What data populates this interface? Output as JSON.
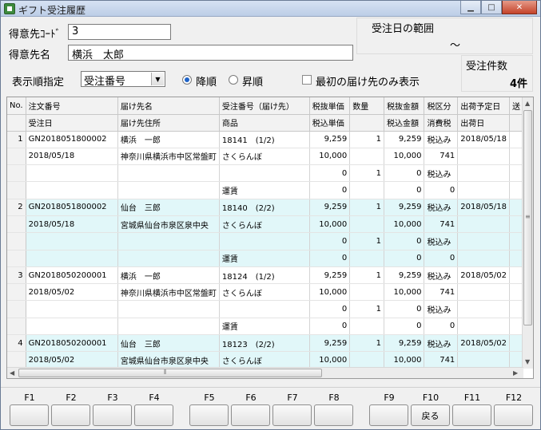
{
  "window": {
    "title": "ギフト受注履歴"
  },
  "form": {
    "customer_code_label": "得意先ｺｰﾄﾞ",
    "customer_code_value": "3",
    "customer_name_label": "得意先名",
    "customer_name_value": "横浜　太郎",
    "date_range_label": "受注日の範囲",
    "date_range_sep": "～",
    "order_count_label": "受注件数",
    "order_count_value": "4件",
    "sort_label": "表示順指定",
    "sort_value": "受注番号",
    "desc_label": "降順",
    "asc_label": "昇順",
    "first_only_label": "最初の届け先のみ表示"
  },
  "grid": {
    "header1": [
      "No.",
      "注文番号",
      "届け先名",
      "受注番号（届け先）",
      "税抜単価",
      "数量",
      "税抜金額",
      "税区分",
      "出荷予定日",
      "送"
    ],
    "header2": [
      "",
      "受注日",
      "届け先住所",
      "商品",
      "税込単価",
      "",
      "税込金額",
      "消費税",
      "出荷日",
      ""
    ],
    "groups": [
      {
        "no": "1",
        "alt": false,
        "rows": [
          [
            "GN2018051800002",
            "横浜　一郎",
            "18141　(1/2)",
            "9,259",
            "1",
            "9,259",
            "税込み",
            "2018/05/18"
          ],
          [
            "2018/05/18",
            "神奈川県横浜市中区常盤町",
            "さくらんぼ",
            "10,000",
            "",
            "10,000",
            "741",
            ""
          ],
          [
            "",
            "",
            "",
            "0",
            "1",
            "0",
            "税込み",
            ""
          ],
          [
            "",
            "",
            "運賃",
            "0",
            "",
            "0",
            "0",
            ""
          ]
        ]
      },
      {
        "no": "2",
        "alt": true,
        "rows": [
          [
            "GN2018051800002",
            "仙台　三郎",
            "18140　(2/2)",
            "9,259",
            "1",
            "9,259",
            "税込み",
            "2018/05/18"
          ],
          [
            "2018/05/18",
            "宮城県仙台市泉区泉中央",
            "さくらんぼ",
            "10,000",
            "",
            "10,000",
            "741",
            ""
          ],
          [
            "",
            "",
            "",
            "0",
            "1",
            "0",
            "税込み",
            ""
          ],
          [
            "",
            "",
            "運賃",
            "0",
            "",
            "0",
            "0",
            ""
          ]
        ]
      },
      {
        "no": "3",
        "alt": false,
        "rows": [
          [
            "GN2018050200001",
            "横浜　一郎",
            "18124　(1/2)",
            "9,259",
            "1",
            "9,259",
            "税込み",
            "2018/05/02"
          ],
          [
            "2018/05/02",
            "神奈川県横浜市中区常盤町",
            "さくらんぼ",
            "10,000",
            "",
            "10,000",
            "741",
            ""
          ],
          [
            "",
            "",
            "",
            "0",
            "1",
            "0",
            "税込み",
            ""
          ],
          [
            "",
            "",
            "運賃",
            "0",
            "",
            "0",
            "0",
            ""
          ]
        ]
      },
      {
        "no": "4",
        "alt": true,
        "rows": [
          [
            "GN2018050200001",
            "仙台　三郎",
            "18123　(2/2)",
            "9,259",
            "1",
            "9,259",
            "税込み",
            "2018/05/02"
          ],
          [
            "2018/05/02",
            "宮城県仙台市泉区泉中央",
            "さくらんぼ",
            "10,000",
            "",
            "10,000",
            "741",
            ""
          ]
        ]
      }
    ]
  },
  "fkeys": [
    {
      "key": "F1",
      "label": ""
    },
    {
      "key": "F2",
      "label": ""
    },
    {
      "key": "F3",
      "label": ""
    },
    {
      "key": "F4",
      "label": ""
    },
    {
      "key": "F5",
      "label": ""
    },
    {
      "key": "F6",
      "label": ""
    },
    {
      "key": "F7",
      "label": ""
    },
    {
      "key": "F8",
      "label": ""
    },
    {
      "key": "F9",
      "label": ""
    },
    {
      "key": "F10",
      "label": "戻る"
    },
    {
      "key": "F11",
      "label": ""
    },
    {
      "key": "F12",
      "label": ""
    }
  ],
  "colors": {
    "alt_row": "#e1f7f9",
    "radio_dot": "#1e63c8",
    "close_button": "#c4432a"
  }
}
